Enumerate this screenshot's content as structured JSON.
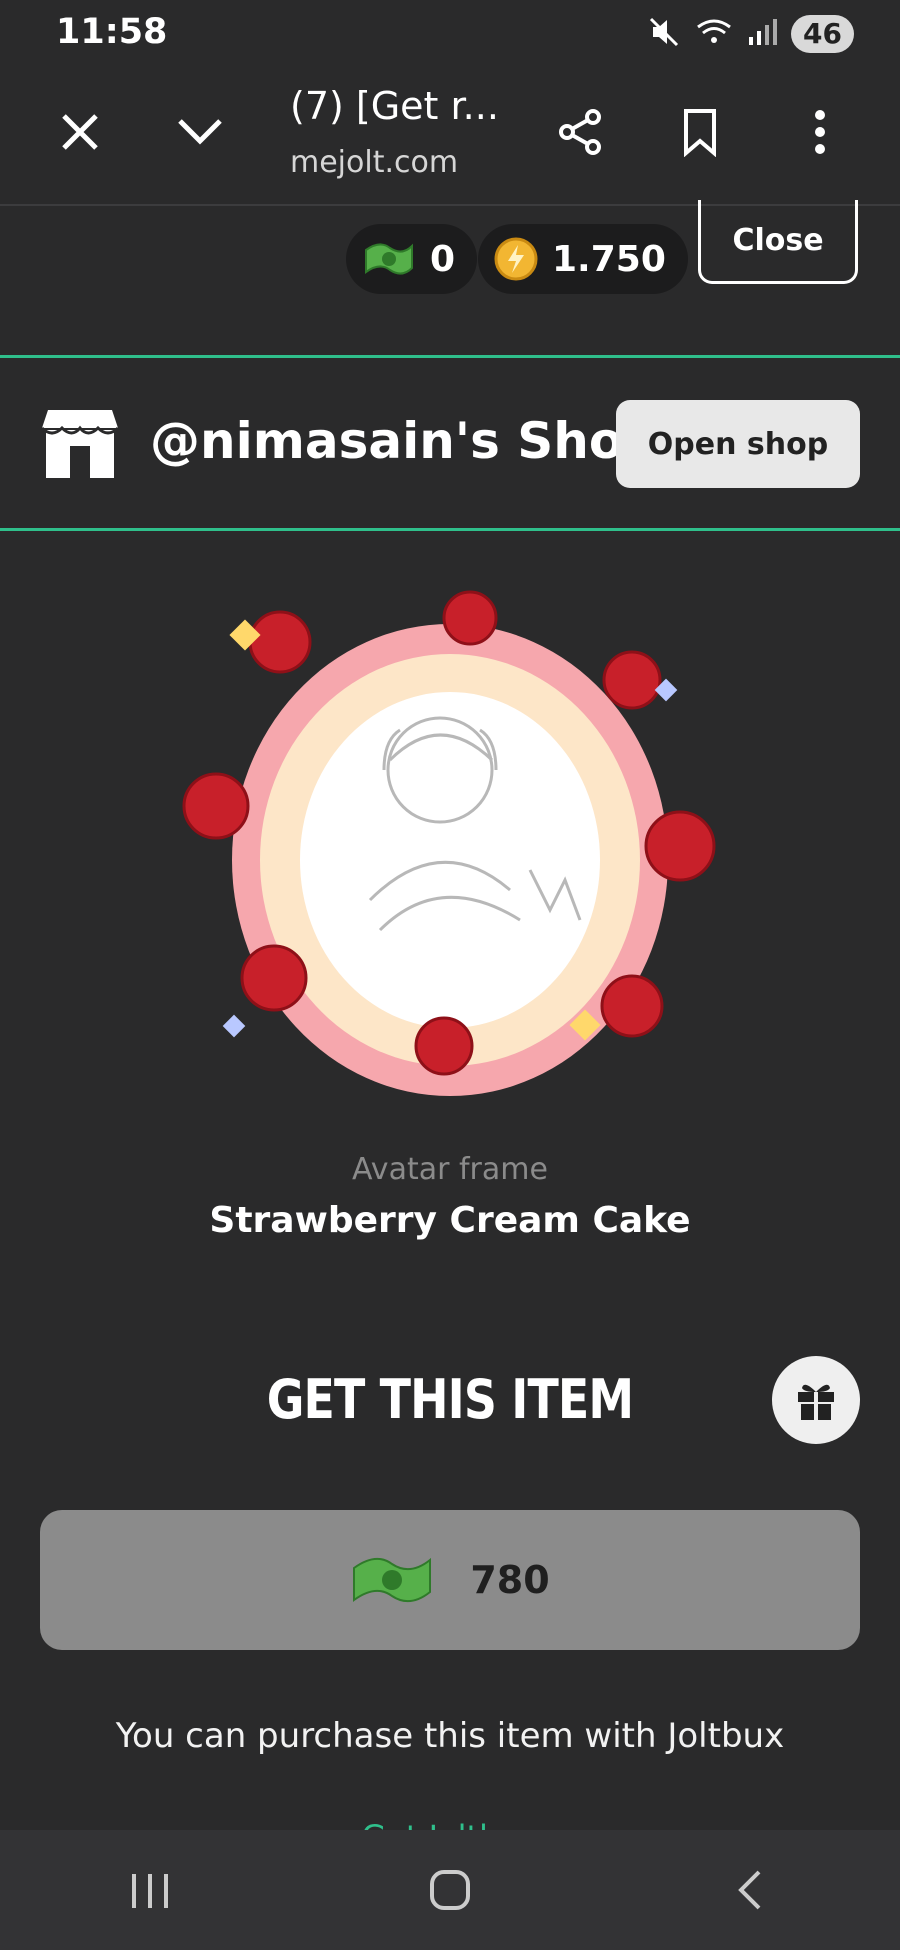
{
  "status_bar": {
    "time": "11:58",
    "battery": "46"
  },
  "browser": {
    "tab_title": "(7) [Get r...",
    "url": "mejolt.com"
  },
  "wallet": {
    "joltbux": "0",
    "coins": "1.750",
    "close_label": "Close"
  },
  "shop": {
    "title": "@nimasain's Shop",
    "open_label": "Open shop"
  },
  "item": {
    "type": "Avatar frame",
    "name": "Strawberry Cream Cake"
  },
  "purchase": {
    "heading": "GET THIS ITEM",
    "price": "780",
    "note": "You can purchase this item with Joltbux",
    "partial_link": "Get Joltbux"
  },
  "colors": {
    "background": "#2a2a2b",
    "accent": "#2fbf8b",
    "price_button": "#8b8b8b"
  },
  "icons": [
    "mute-icon",
    "wifi-icon",
    "signal-icon",
    "close-icon",
    "chevron-down-icon",
    "share-icon",
    "bookmark-icon",
    "more-icon",
    "joltbux-icon",
    "coin-icon",
    "store-icon",
    "gift-icon",
    "recents-icon",
    "home-icon",
    "back-icon"
  ]
}
